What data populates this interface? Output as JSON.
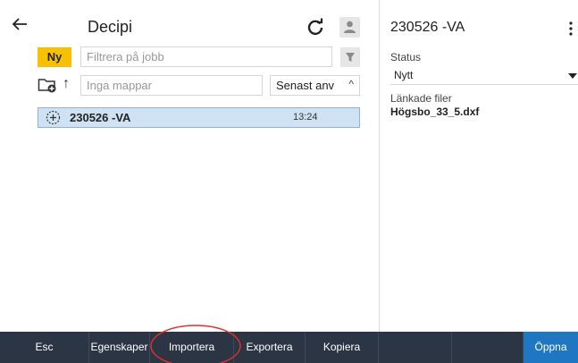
{
  "header": {
    "title": "Decipi"
  },
  "filters": {
    "new_label": "Ny",
    "filter_placeholder": "Filtrera på jobb",
    "folder_placeholder": "Inga mappar",
    "sort_label": "Senast anv",
    "sort_chevron": "^"
  },
  "jobs": [
    {
      "name": "230526 -VA",
      "time": "13:24"
    }
  ],
  "details": {
    "title": "230526 -VA",
    "status_label": "Status",
    "status_value": "Nytt",
    "linked_label": "Länkade filer",
    "linked_file": "Högsbo_33_5.dxf"
  },
  "toolbar": {
    "items": [
      "Esc",
      "Egenskaper",
      "Importera",
      "Exportera",
      "Kopiera",
      "",
      "",
      "Öppna"
    ]
  },
  "colors": {
    "accent_yellow": "#f7c100",
    "selected_row": "#cfe2f3",
    "toolbar_bg": "#2b3544",
    "open_button": "#1f77c2",
    "annotation": "#e0312b"
  },
  "icons": [
    "back-arrow-icon",
    "refresh-icon",
    "user-icon",
    "filter-funnel-icon",
    "folder-add-icon",
    "up-arrow-icon",
    "plus-circle-icon",
    "kebab-menu-icon",
    "dropdown-caret-icon"
  ]
}
